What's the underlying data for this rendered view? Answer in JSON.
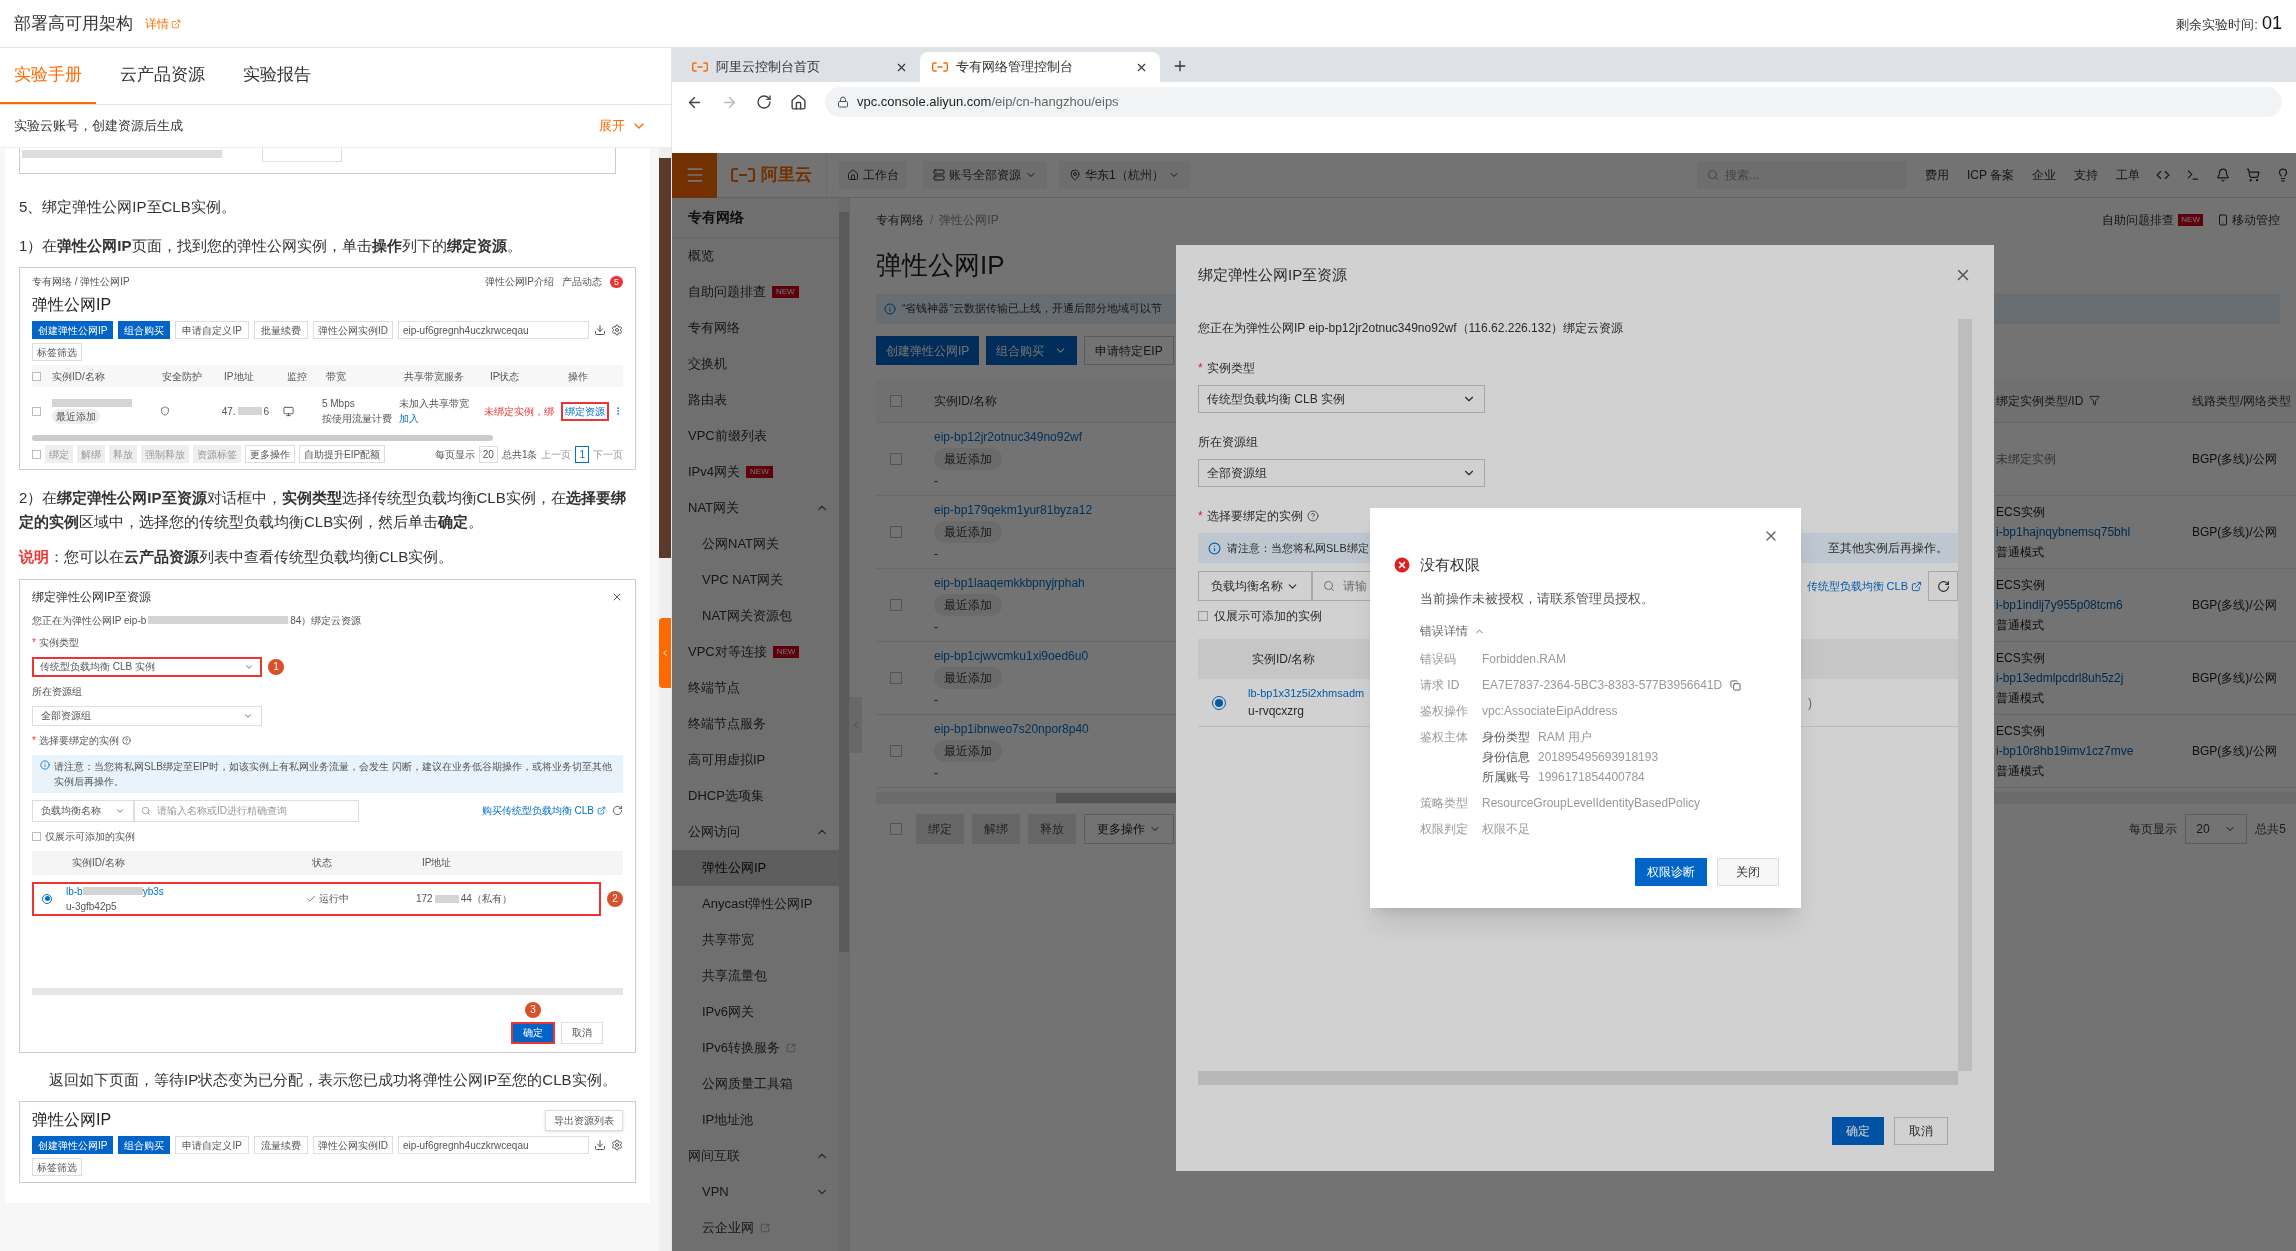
{
  "header": {
    "title": "部署高可用架构",
    "details_link": "详情",
    "timer_label": "剩余实验时间:",
    "timer_value": "01"
  },
  "left_tabs": [
    {
      "label": "实验手册",
      "selected": true
    },
    {
      "label": "云产品资源",
      "selected": false
    },
    {
      "label": "实验报告",
      "selected": false
    }
  ],
  "account_bar": {
    "text": "实验云账号，创建资源后生成",
    "expand": "展开"
  },
  "manual": {
    "step_title": "5、绑定弹性公网IP至CLB实例。",
    "step1": "1）在**弹性公网IP**页面，找到您的弹性公网实例，单击**操作**列下的**绑定资源**。",
    "shot1": {
      "breadcrumb": "专有网络 / 弹性公网IP",
      "help_links": [
        "弹性公网IP介绍",
        "产品动态"
      ],
      "badge": "5",
      "title": "弹性公网IP",
      "buttons": [
        {
          "label": "创建弹性公网IP",
          "primary": true
        },
        {
          "label": "组合购买",
          "primary": true
        },
        {
          "label": "申请自定义IP",
          "primary": false
        },
        {
          "label": "批量续费",
          "primary": false
        }
      ],
      "filter": "弹性公网实例ID",
      "search": "eip-uf6gregnh4uczkrwceqau",
      "tag_filter": "标签筛选",
      "header_checked": false,
      "footer_checked": false,
      "columns": [
        "实例ID/名称",
        "安全防护",
        "IP地址",
        "监控",
        "带宽",
        "共享带宽服务",
        "IP状态",
        "操作"
      ],
      "row": {
        "checked": false,
        "tag": "最近添加",
        "ip_prefix": "47.",
        "ip_suffix": "6",
        "bandwidth": "5 Mbps",
        "billing": "按使用流量计费",
        "shared": "未加入共享带宽",
        "join": "加入",
        "status": "未绑定实例，绑",
        "action": "绑定资源"
      },
      "footer_buttons": [
        {
          "label": "绑定",
          "disabled": true
        },
        {
          "label": "解绑",
          "disabled": true
        },
        {
          "label": "释放",
          "disabled": true
        },
        {
          "label": "强制释放",
          "disabled": true
        },
        {
          "label": "资源标签",
          "disabled": true
        },
        {
          "label": "更多操作",
          "disabled": false
        },
        {
          "label": "自助提升EIP配额",
          "disabled": false
        }
      ],
      "page_size_label": "每页显示",
      "page_size": "20",
      "total": "总共1条",
      "prev": "上一页",
      "page": "1",
      "next": "下一页"
    },
    "step2": "2）在**绑定弹性公网IP至资源**对话框中，**实例类型**选择传统型负载均衡CLB实例，在**选择要绑定的实例**区域中，选择您的传统型负载均衡CLB实例，然后单击**确定**。",
    "note_label": "说明",
    "note": "：您可以在**云产品资源**列表中查看传统型负载均衡CLB实例。",
    "shot2": {
      "title": "绑定弹性公网IP至资源",
      "intro_prefix": "您正在为弹性公网IP eip-b",
      "intro_suffix": "84）绑定云资源",
      "type_label": "实例类型",
      "type_value": "传统型负载均衡 CLB 实例",
      "group_label": "所在资源组",
      "group_value": "全部资源组",
      "select_label": "选择要绑定的实例",
      "notice": "请注意：当您将私网SLB绑定至EIP时，如该实例上有私网业务流量，会发生 闪断，建议在业务低谷期操作，或将业务切至其他实例后再操作。",
      "filter": "负载均衡名称",
      "search_placeholder": "请输入名称或ID进行精确查询",
      "buy_link": "购买传统型负载均衡 CLB",
      "only_addable": "仅展示可添加的实例",
      "only_addable_checked": false,
      "required_mark": "*",
      "columns": [
        "实例ID/名称",
        "状态",
        "IP地址"
      ],
      "row": {
        "selected": true,
        "id_prefix": "lb-b",
        "id_suffix": "yb3s",
        "name": "u-3gfb42p5",
        "status": "运行中",
        "ip_prefix": "172",
        "ip_suffix": "44（私有）"
      },
      "callouts": [
        "1",
        "2",
        "3"
      ],
      "ok": "确定",
      "cancel": "取消"
    },
    "step3": "返回如下页面，等待IP状态变为已分配，表示您已成功将弹性公网IP至您的CLB实例。",
    "shot3": {
      "title": "弹性公网IP",
      "export": "导出资源列表",
      "buttons": [
        {
          "label": "创建弹性公网IP",
          "primary": true
        },
        {
          "label": "组合购买",
          "primary": true
        },
        {
          "label": "申请自定义IP",
          "primary": false
        },
        {
          "label": "流量续费",
          "primary": false
        }
      ],
      "filter": "弹性公网实例ID",
      "search": "eip-uf6gregnh4uczkrwceqau",
      "tag_filter": "标签筛选"
    }
  },
  "browser": {
    "tabs": [
      {
        "title": "阿里云控制台首页",
        "selected": false
      },
      {
        "title": "专有网络管理控制台",
        "selected": true
      }
    ],
    "url_host": "vpc.console.aliyun.com",
    "url_path": "/eip/cn-hangzhou/eips"
  },
  "console_nav": {
    "logo": "阿里云",
    "workbench": "工作台",
    "resources": "账号全部资源",
    "region": "华东1（杭州）",
    "search_placeholder": "搜索...",
    "links": [
      "费用",
      "ICP 备案",
      "企业",
      "支持",
      "工单"
    ]
  },
  "sidebar": {
    "title": "专有网络",
    "items": [
      {
        "label": "概览",
        "selected": false
      },
      {
        "label": "自助问题排查",
        "badge": "NEW",
        "selected": false
      },
      {
        "label": "专有网络",
        "selected": false
      },
      {
        "label": "交换机",
        "selected": false
      },
      {
        "label": "路由表",
        "selected": false
      },
      {
        "label": "VPC前缀列表",
        "selected": false
      },
      {
        "label": "IPv4网关",
        "badge": "NEW",
        "selected": false
      },
      {
        "label": "NAT网关",
        "selected": false,
        "expanded": true,
        "children": [
          {
            "label": "公网NAT网关",
            "selected": false
          },
          {
            "label": "VPC NAT网关",
            "selected": false
          },
          {
            "label": "NAT网关资源包",
            "selected": false
          }
        ]
      },
      {
        "label": "VPC对等连接",
        "badge": "NEW",
        "selected": false
      },
      {
        "label": "终端节点",
        "selected": false
      },
      {
        "label": "终端节点服务",
        "selected": false
      },
      {
        "label": "高可用虚拟IP",
        "selected": false
      },
      {
        "label": "DHCP选项集",
        "selected": false
      },
      {
        "label": "公网访问",
        "selected": false,
        "expanded": true,
        "children": [
          {
            "label": "弹性公网IP",
            "selected": true
          },
          {
            "label": "Anycast弹性公网IP",
            "selected": false
          },
          {
            "label": "共享带宽",
            "selected": false
          },
          {
            "label": "共享流量包",
            "selected": false
          },
          {
            "label": "IPv6网关",
            "selected": false
          },
          {
            "label": "IPv6转换服务",
            "external": true,
            "selected": false
          },
          {
            "label": "公网质量工具箱",
            "selected": false
          },
          {
            "label": "IP地址池",
            "selected": false
          }
        ]
      },
      {
        "label": "网间互联",
        "selected": false,
        "expanded": true,
        "children": [
          {
            "label": "VPN",
            "selected": false,
            "expanded": false
          },
          {
            "label": "云企业网",
            "external": true,
            "selected": false
          }
        ]
      }
    ]
  },
  "page": {
    "breadcrumb": [
      "专有网络",
      "/",
      "弹性公网IP"
    ],
    "help": {
      "label": "自助问题排查",
      "badge": "NEW"
    },
    "mobile": "移动管控",
    "title": "弹性公网IP",
    "notice": "“省钱神器”云数据传输已上线，开通后部分地域可以节",
    "buttons": [
      {
        "label": "创建弹性公网IP",
        "primary": true,
        "dropdown": false
      },
      {
        "label": "组合购买",
        "primary": true,
        "dropdown": true
      },
      {
        "label": "申请特定EIP",
        "primary": false,
        "dropdown": false
      }
    ],
    "select_all_checked": false,
    "columns": {
      "id": "实例ID/名称",
      "binding": "绑定实例类型/ID",
      "line": "线路类型/网络类型"
    },
    "rows": [
      {
        "id": "eip-bp12jr2otnuc349no92wf",
        "checked": false,
        "tag": "最近添加",
        "name": "-",
        "bound": false,
        "binding_type": "未绑定实例",
        "line": "BGP(多线)/公网"
      },
      {
        "id": "eip-bp179qekm1yur81byza12",
        "checked": false,
        "tag": "最近添加",
        "name": "-",
        "bound": true,
        "binding_type": "ECS实例",
        "instance": "i-bp1hajnqybnemsq75bhl",
        "mode": "普通模式",
        "line": "BGP(多线)/公网"
      },
      {
        "id": "eip-bp1laaqemkkbpnyjrphah",
        "checked": false,
        "tag": "最近添加",
        "name": "-",
        "bound": true,
        "binding_type": "ECS实例",
        "instance": "i-bp1indlj7y955p08tcm6",
        "mode": "普通模式",
        "line": "BGP(多线)/公网"
      },
      {
        "id": "eip-bp1cjwvcmku1xi9oed6u0",
        "checked": false,
        "tag": "最近添加",
        "name": "-",
        "bound": true,
        "binding_type": "ECS实例",
        "instance": "i-bp13edmlpcdrl8uh5z2j",
        "mode": "普通模式",
        "line": "BGP(多线)/公网"
      },
      {
        "id": "eip-bp1ibnweo7s20npor8p40",
        "checked": false,
        "tag": "最近添加",
        "name": "-",
        "bound": true,
        "binding_type": "ECS实例",
        "instance": "i-bp10r8hb19imv1cz7mve",
        "mode": "普通模式",
        "line": "BGP(多线)/公网"
      }
    ],
    "bulk_checked": false,
    "bulk_buttons": [
      {
        "label": "绑定",
        "disabled": true
      },
      {
        "label": "解绑",
        "disabled": true
      },
      {
        "label": "释放",
        "disabled": true
      },
      {
        "label": "更多操作",
        "disabled": false
      }
    ],
    "page_size_label": "每页显示",
    "page_size": "20",
    "total": "总共5"
  },
  "bind_dialog": {
    "title": "绑定弹性公网IP至资源",
    "intro": "您正在为弹性公网IP eip-bp12jr2otnuc349no92wf（116.62.226.132）绑定云资源",
    "type_label": "实例类型",
    "type_value": "传统型负载均衡 CLB 实例",
    "group_label": "所在资源组",
    "group_value": "全部资源组",
    "select_label": "选择要绑定的实例",
    "notice_left": "请注意：当您将私网SLB绑定",
    "notice_right": "至其他实例后再操作。",
    "filter": "负载均衡名称",
    "search_placeholder": "请输",
    "buy_link": "传统型负载均衡 CLB",
    "only_addable": "仅展示可添加的实例",
    "only_addable_checked": false,
    "required_mark": "*",
    "column": "实例ID/名称",
    "row": {
      "selected": true,
      "id": "lb-bp1x31z5i2xhmsadm",
      "name": "u-rvqcxzrg",
      "tail": ")"
    },
    "ok": "确定",
    "cancel": "取消"
  },
  "error_dialog": {
    "title": "没有权限",
    "message": "当前操作未被授权，请联系管理员授权。",
    "details_label": "错误详情",
    "expanded": true,
    "details": [
      {
        "label": "错误码",
        "value": "Forbidden.RAM"
      },
      {
        "label": "请求 ID",
        "value": "EA7E7837-2364-5BC3-8383-577B3956641D",
        "copyable": true
      },
      {
        "label": "鉴权操作",
        "value": "vpc:AssociateEipAddress"
      },
      {
        "label": "鉴权主体",
        "sub": [
          {
            "label": "身份类型",
            "value": "RAM 用户"
          },
          {
            "label": "身份信息",
            "value": "201895495693918193"
          },
          {
            "label": "所属账号",
            "value": "1996171854400784"
          }
        ]
      },
      {
        "label": "策略类型",
        "value": "ResourceGroupLevelIdentityBasedPolicy"
      },
      {
        "label": "权限判定",
        "value": "权限不足"
      }
    ],
    "primary": "权限诊断",
    "close": "关闭"
  }
}
